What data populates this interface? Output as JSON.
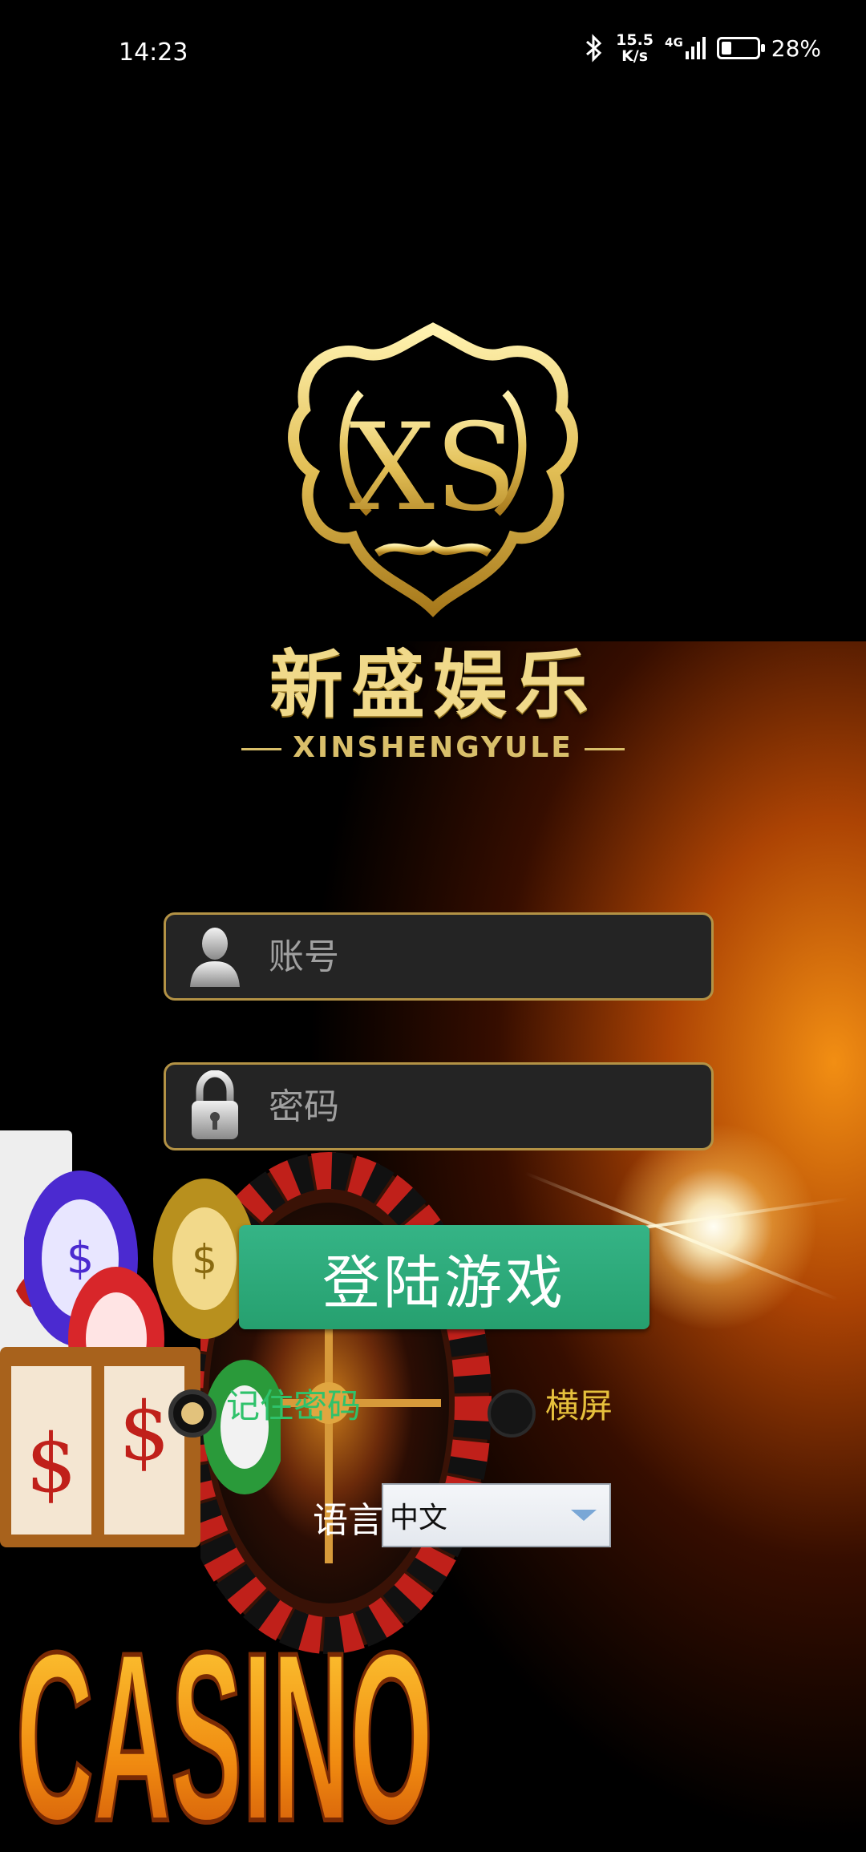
{
  "status_bar": {
    "time": "14:23",
    "net_speed_value": "15.5",
    "net_speed_unit": "K/s",
    "network_type": "4G",
    "battery_percent": "28%",
    "battery_level": 0.28
  },
  "brand": {
    "monogram": "XS",
    "name_cn": "新盛娱乐",
    "name_en": "XINSHENGYULE"
  },
  "background": {
    "casino_sign": "CASINO"
  },
  "login": {
    "account_placeholder": "账号",
    "password_placeholder": "密码",
    "submit_label": "登陆游戏",
    "remember_label": "记住密码",
    "landscape_label": "横屏",
    "language_label": "语言",
    "language_value": "中文"
  },
  "colors": {
    "gold": "#d9bf6a",
    "button_green": "#2aa874",
    "remember_green": "#2fc26b",
    "landscape_yellow": "#e6c03c"
  }
}
